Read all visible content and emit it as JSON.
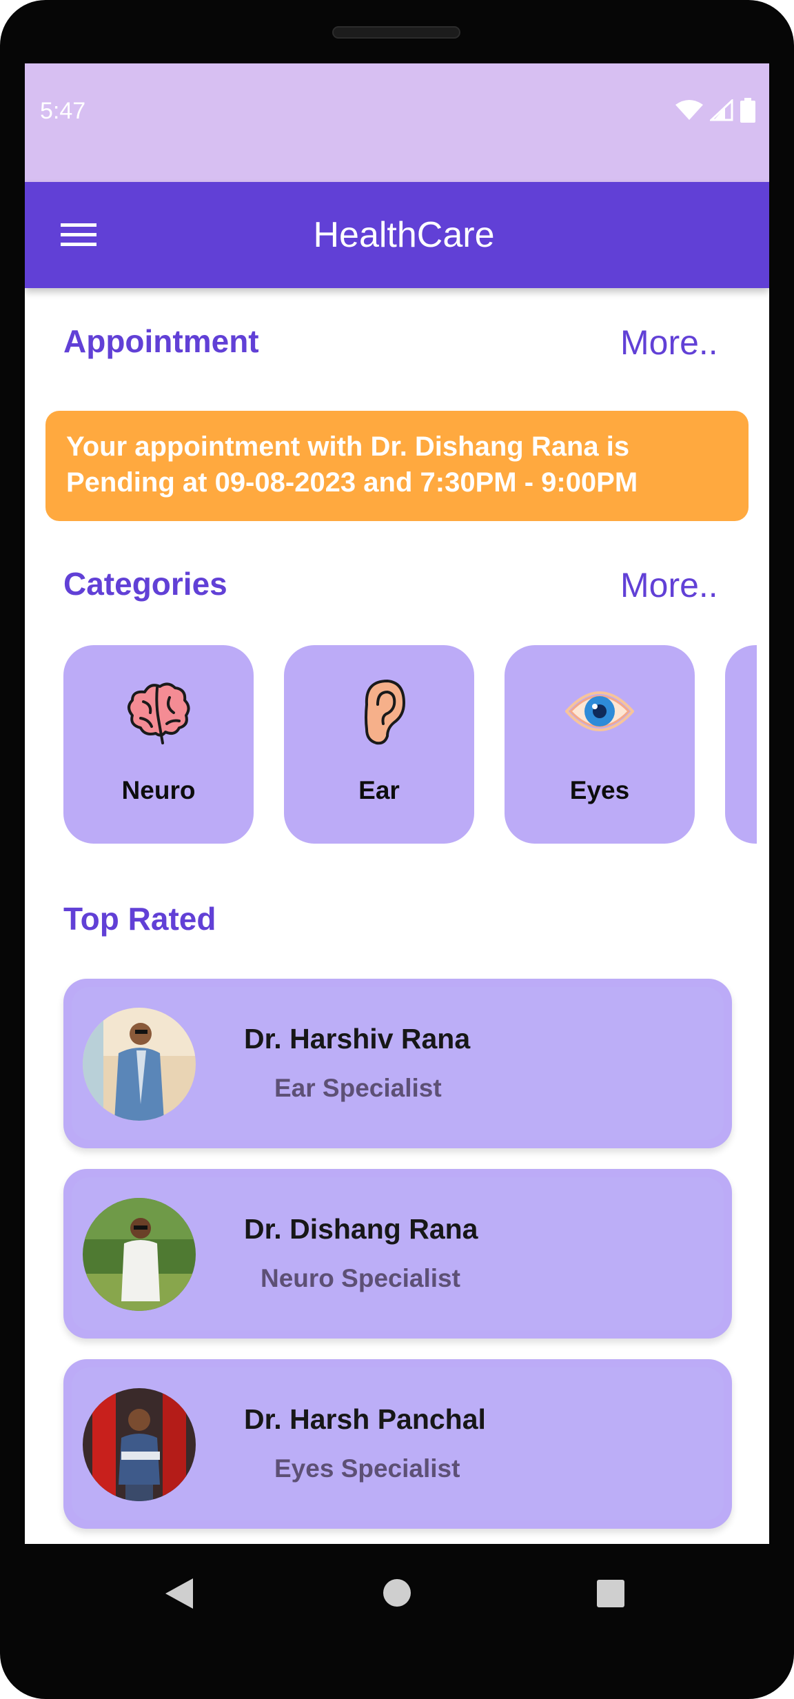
{
  "status_bar": {
    "time": "5:47",
    "icons": [
      "wifi-icon",
      "cell-signal-icon",
      "battery-icon"
    ]
  },
  "app_bar": {
    "title": "HealthCare",
    "menu_icon": "hamburger-menu-icon"
  },
  "appointment": {
    "header": "Appointment",
    "more": "More..",
    "banner_text": "Your appointment with Dr. Dishang Rana is\nPending at  09-08-2023 and  7:30PM - 9:00PM"
  },
  "categories": {
    "header": "Categories",
    "more": "More..",
    "items": [
      {
        "label": "Neuro",
        "icon": "brain-icon"
      },
      {
        "label": "Ear",
        "icon": "ear-icon"
      },
      {
        "label": "Eyes",
        "icon": "eye-icon"
      }
    ]
  },
  "top_rated": {
    "header": "Top Rated",
    "doctors": [
      {
        "name": "Dr. Harshiv Rana",
        "specialty": "Ear Specialist"
      },
      {
        "name": "Dr. Dishang Rana",
        "specialty": "Neuro Specialist"
      },
      {
        "name": "Dr. Harsh Panchal",
        "specialty": "Eyes Specialist"
      }
    ]
  },
  "colors": {
    "status_bar": "#d7bff2",
    "app_bar": "#6140d6",
    "accent_text": "#6140d6",
    "banner": "#ffa93f",
    "card": "#bcabf7",
    "specialty_text": "#5d5075"
  },
  "nav": {
    "icons": [
      "back-triangle-icon",
      "home-circle-icon",
      "recents-square-icon"
    ]
  }
}
